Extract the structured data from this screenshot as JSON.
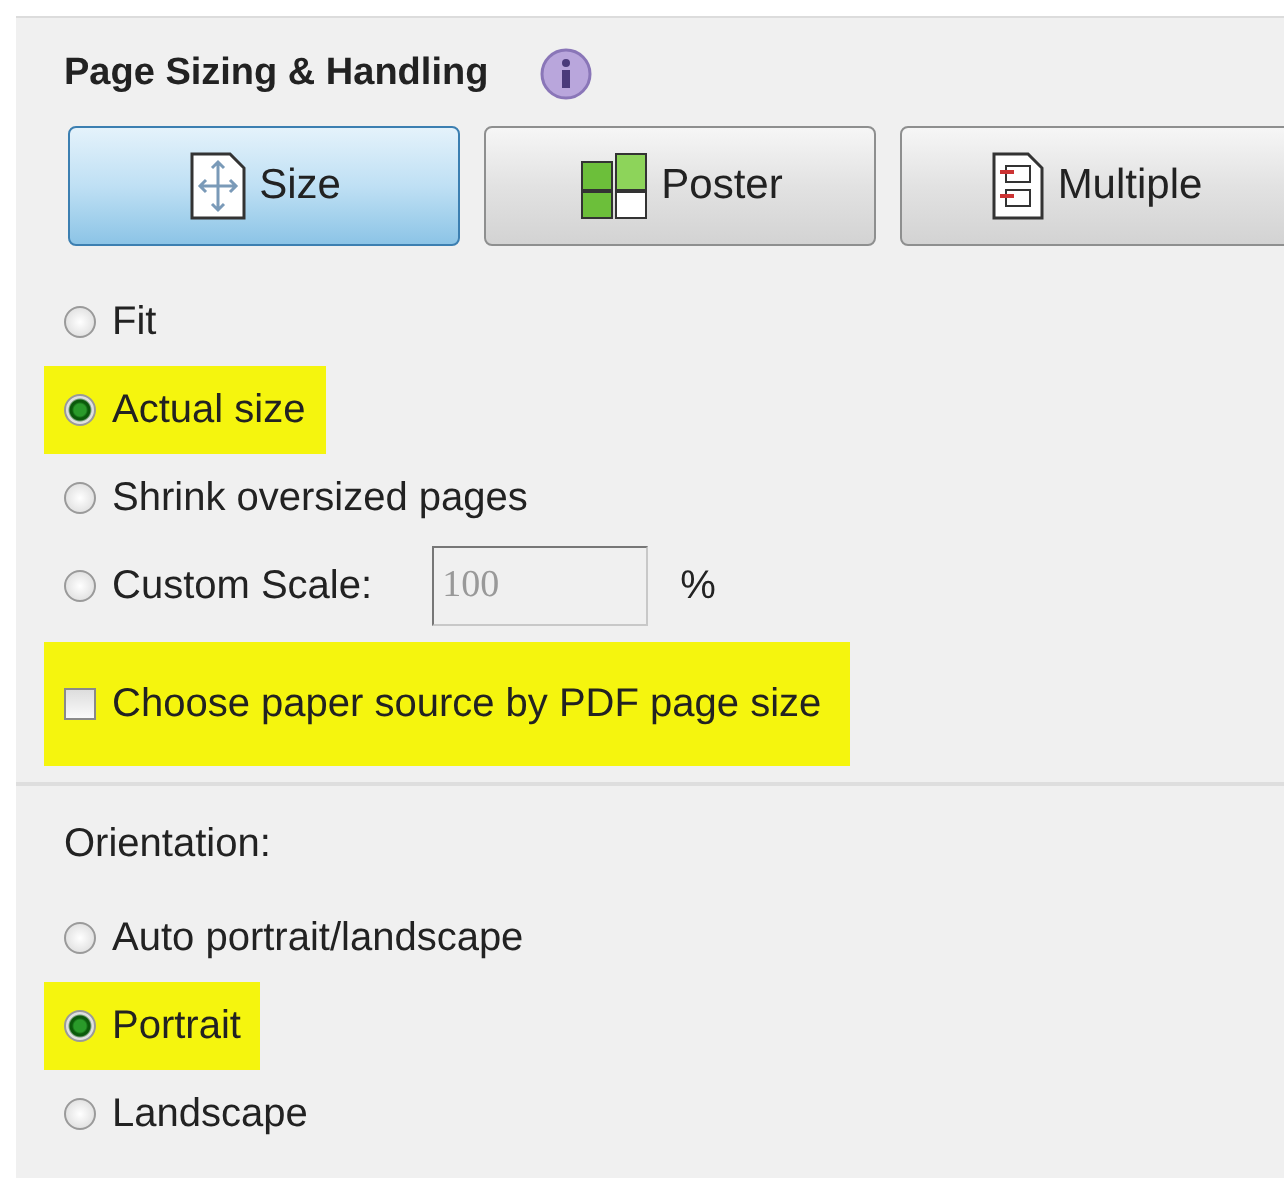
{
  "page_sizing": {
    "title": "Page Sizing & Handling",
    "buttons": [
      {
        "label": "Size",
        "kind": "size",
        "selected": true
      },
      {
        "label": "Poster",
        "kind": "poster",
        "selected": false
      },
      {
        "label": "Multiple",
        "kind": "multiple",
        "selected": false
      }
    ],
    "options": [
      {
        "kind": "radio",
        "label": "Fit",
        "selected": false,
        "highlighted": false
      },
      {
        "kind": "radio",
        "label": "Actual size",
        "selected": true,
        "highlighted": true
      },
      {
        "kind": "radio",
        "label": "Shrink oversized pages",
        "selected": false,
        "highlighted": false
      },
      {
        "kind": "scale",
        "label": "Custom Scale:",
        "selected": false,
        "highlighted": false,
        "value": "100",
        "unit": "%"
      },
      {
        "kind": "checkbox",
        "label": "Choose paper source by PDF page size",
        "checked": false,
        "highlighted": true
      }
    ]
  },
  "orientation": {
    "label": "Orientation:",
    "options": [
      {
        "kind": "radio",
        "label": "Auto portrait/landscape",
        "selected": false,
        "highlighted": false
      },
      {
        "kind": "radio",
        "label": "Portrait",
        "selected": true,
        "highlighted": true
      },
      {
        "kind": "radio",
        "label": "Landscape",
        "selected": false,
        "highlighted": false
      }
    ]
  }
}
